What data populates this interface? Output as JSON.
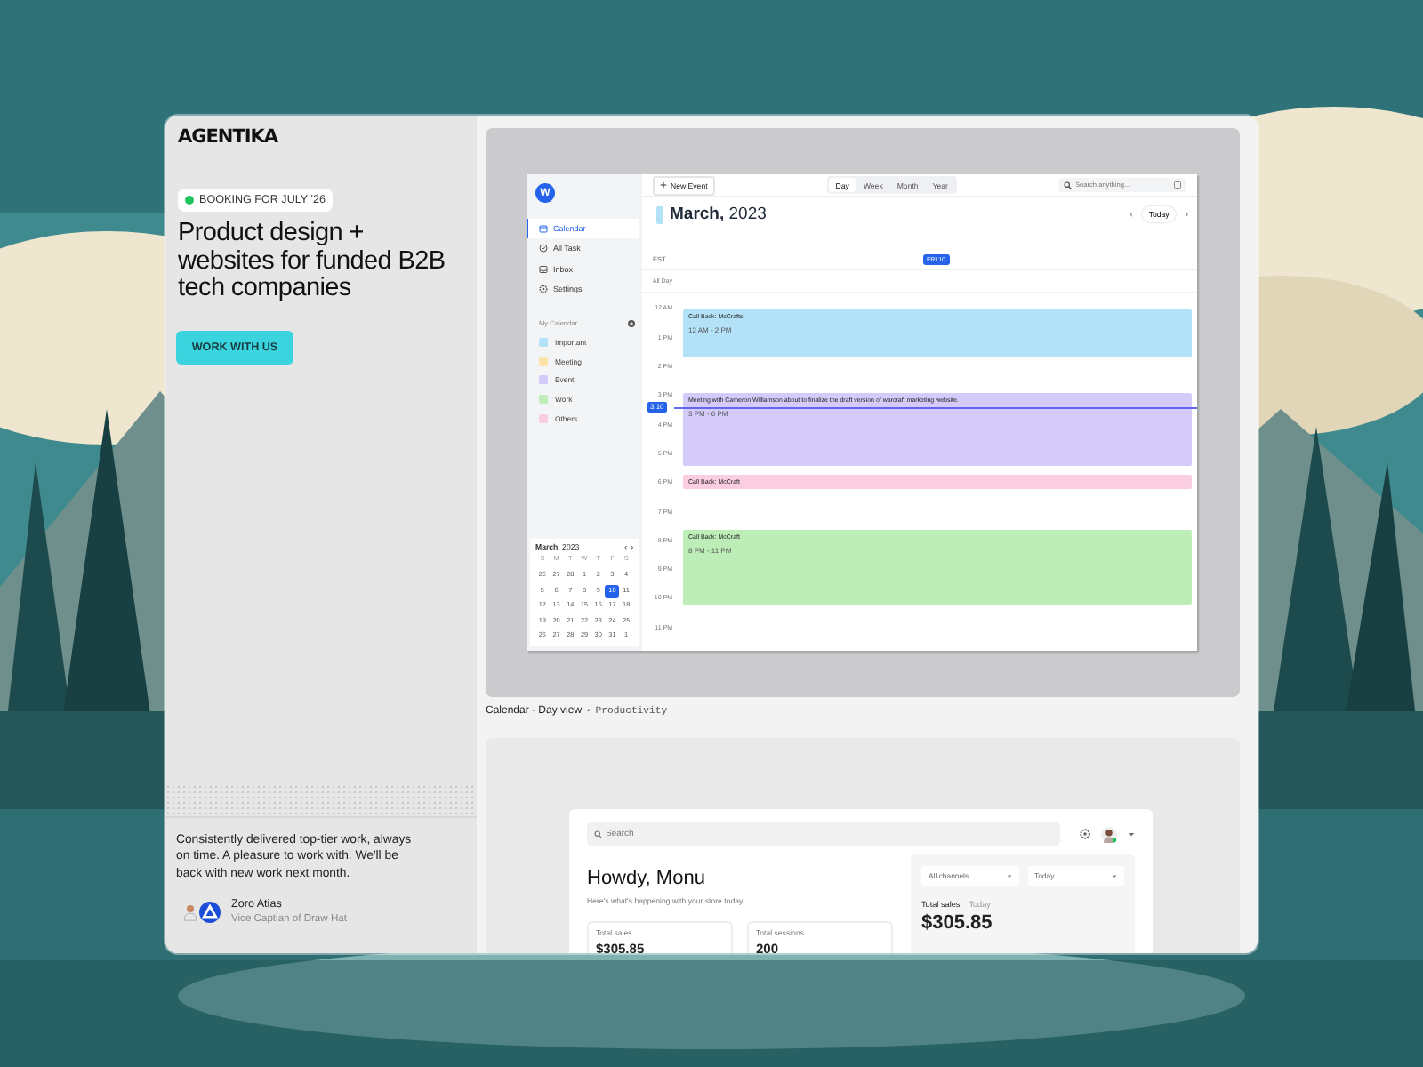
{
  "brand": "AGENTIKA",
  "badge": "BOOKING FOR JULY '26",
  "headline": "Product design + websites for funded B2B tech companies",
  "cta": "WORK WITH US",
  "testimonial": {
    "quote": "Consistently delivered top-tier work, always on time. A pleasure to work with. We'll be back with new work next month.",
    "name": "Zoro Atias",
    "role": "Vice Captian of Draw Hat"
  },
  "calendar_app": {
    "logo_letter": "W",
    "nav": [
      {
        "label": "Calendar",
        "selected": true
      },
      {
        "label": "All Task",
        "selected": false
      },
      {
        "label": "Inbox",
        "selected": false
      },
      {
        "label": "Settings",
        "selected": false
      }
    ],
    "my_calendar_label": "My Calendar",
    "calendars": [
      {
        "label": "Important",
        "color": "#b3e1f7"
      },
      {
        "label": "Meeting",
        "color": "#fbe3a7"
      },
      {
        "label": "Event",
        "color": "#d4cbfb"
      },
      {
        "label": "Work",
        "color": "#bdeeb8"
      },
      {
        "label": "Others",
        "color": "#fbcde0"
      }
    ],
    "mini_calendar": {
      "month": "March,",
      "year": "2023",
      "prev": "‹",
      "next": "›",
      "weekdays": [
        "S",
        "M",
        "T",
        "W",
        "T",
        "F",
        "S"
      ],
      "weeks": [
        [
          {
            "d": "26",
            "selected": false
          },
          {
            "d": "27",
            "selected": false
          },
          {
            "d": "28",
            "selected": false
          },
          {
            "d": "1",
            "selected": false
          },
          {
            "d": "2",
            "selected": false
          },
          {
            "d": "3",
            "selected": false
          },
          {
            "d": "4",
            "selected": false
          }
        ],
        [
          {
            "d": "5",
            "selected": false
          },
          {
            "d": "6",
            "selected": false
          },
          {
            "d": "7",
            "selected": false
          },
          {
            "d": "8",
            "selected": false
          },
          {
            "d": "9",
            "selected": false
          },
          {
            "d": "10",
            "selected": true
          },
          {
            "d": "11",
            "selected": false
          }
        ],
        [
          {
            "d": "12",
            "selected": false
          },
          {
            "d": "13",
            "selected": false
          },
          {
            "d": "14",
            "selected": false
          },
          {
            "d": "15",
            "selected": false
          },
          {
            "d": "16",
            "selected": false
          },
          {
            "d": "17",
            "selected": false
          },
          {
            "d": "18",
            "selected": false
          }
        ],
        [
          {
            "d": "19",
            "selected": false
          },
          {
            "d": "20",
            "selected": false
          },
          {
            "d": "21",
            "selected": false
          },
          {
            "d": "22",
            "selected": false
          },
          {
            "d": "23",
            "selected": false
          },
          {
            "d": "24",
            "selected": false
          },
          {
            "d": "25",
            "selected": false
          }
        ],
        [
          {
            "d": "26",
            "selected": false
          },
          {
            "d": "27",
            "selected": false
          },
          {
            "d": "28",
            "selected": false
          },
          {
            "d": "29",
            "selected": false
          },
          {
            "d": "30",
            "selected": false
          },
          {
            "d": "31",
            "selected": false
          },
          {
            "d": "1",
            "selected": false
          }
        ]
      ]
    },
    "new_event": "New Event",
    "views": [
      {
        "label": "Day",
        "selected": true
      },
      {
        "label": "Week",
        "selected": false
      },
      {
        "label": "Month",
        "selected": false
      },
      {
        "label": "Year",
        "selected": false
      }
    ],
    "search_placeholder": "Search anything...",
    "title_month": "March,",
    "title_year": "2023",
    "today": "Today",
    "prev": "‹",
    "next": "›",
    "timezone": "EST",
    "day_badge": "FRI 10",
    "all_day": "All Day",
    "hours": [
      "12 AM",
      "1 PM",
      "2 PM",
      "3 PM",
      "4 PM",
      "5 PM",
      "6 PM",
      "7 PM",
      "8 PM",
      "9 PM",
      "10 PM",
      "11 PM"
    ],
    "now_badge": "3:10",
    "events": [
      {
        "title": "Call Back: McCrafts",
        "time": "12 AM - 2 PM",
        "color": "#b3e1f7"
      },
      {
        "title": "Meeting with Cameron Williamson about to finalize the draft version of warcraft marketing website.",
        "time": "3 PM - 6 PM",
        "color": "#d4cbfb"
      },
      {
        "title": "Call Back: McCraft",
        "color": "#fbcde0"
      },
      {
        "title": "Call Back: McCraft",
        "time": "8 PM - 11 PM",
        "color": "#bdeeb8"
      }
    ]
  },
  "caption": {
    "title": "Calendar - Day view",
    "separator": "•",
    "category": "Productivity"
  },
  "dashboard": {
    "search_placeholder": "Search",
    "greeting": "Howdy, Monu",
    "subtitle": "Here's what's happening with your store today.",
    "stats": [
      {
        "label": "Total sales",
        "value": "$305.85"
      },
      {
        "label": "Total sessions",
        "value": "200"
      }
    ],
    "channel_select": "All channels",
    "period_select": "Today",
    "tabs": [
      {
        "label": "Total sales",
        "selected": true
      },
      {
        "label": "Today",
        "selected": false
      }
    ],
    "total": "$305.85"
  }
}
